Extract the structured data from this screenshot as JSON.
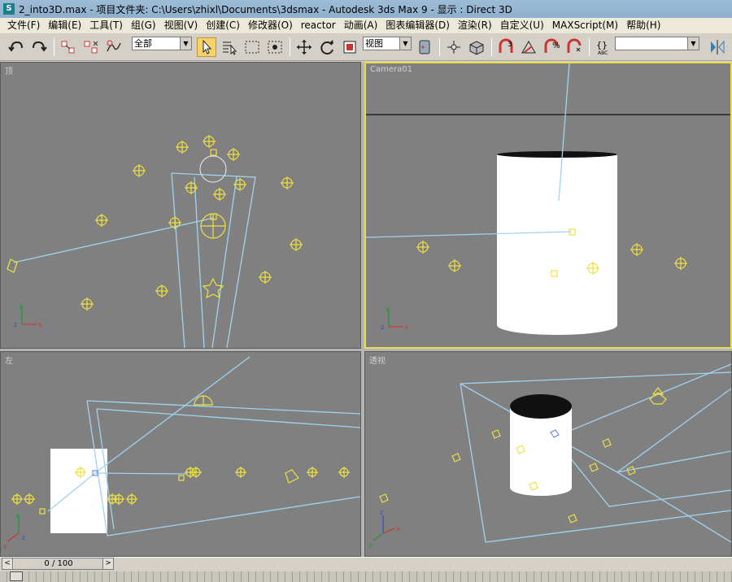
{
  "window": {
    "title": "2_into3D.max    - 项目文件夹: C:\\Users\\zhixl\\Documents\\3dsmax     - Autodesk 3ds Max 9     - 显示 : Direct 3D",
    "logo": "S"
  },
  "menu": [
    "文件(F)",
    "编辑(E)",
    "工具(T)",
    "组(G)",
    "视图(V)",
    "创建(C)",
    "修改器(O)",
    "reactor",
    "动画(A)",
    "图表编辑器(D)",
    "渲染(R)",
    "自定义(U)",
    "MAXScript(M)",
    "帮助(H)"
  ],
  "toolbar": {
    "selection_filter": "全部",
    "coord_system": "视图",
    "named_selection": ""
  },
  "viewports": {
    "top": {
      "label": "顶"
    },
    "camera": {
      "label": "Camera01"
    },
    "left": {
      "label": "左"
    },
    "perspective": {
      "label": "透视"
    }
  },
  "axis": {
    "x": "x",
    "y": "y",
    "z": "z"
  },
  "status": {
    "frame_counter": "0 / 100",
    "prev": "<",
    "next": ">"
  },
  "colors": {
    "viewport_bg": "#808080",
    "active_border": "#e8df4a",
    "light_helper": "#f0e040",
    "wire": "#9fd3f0"
  }
}
